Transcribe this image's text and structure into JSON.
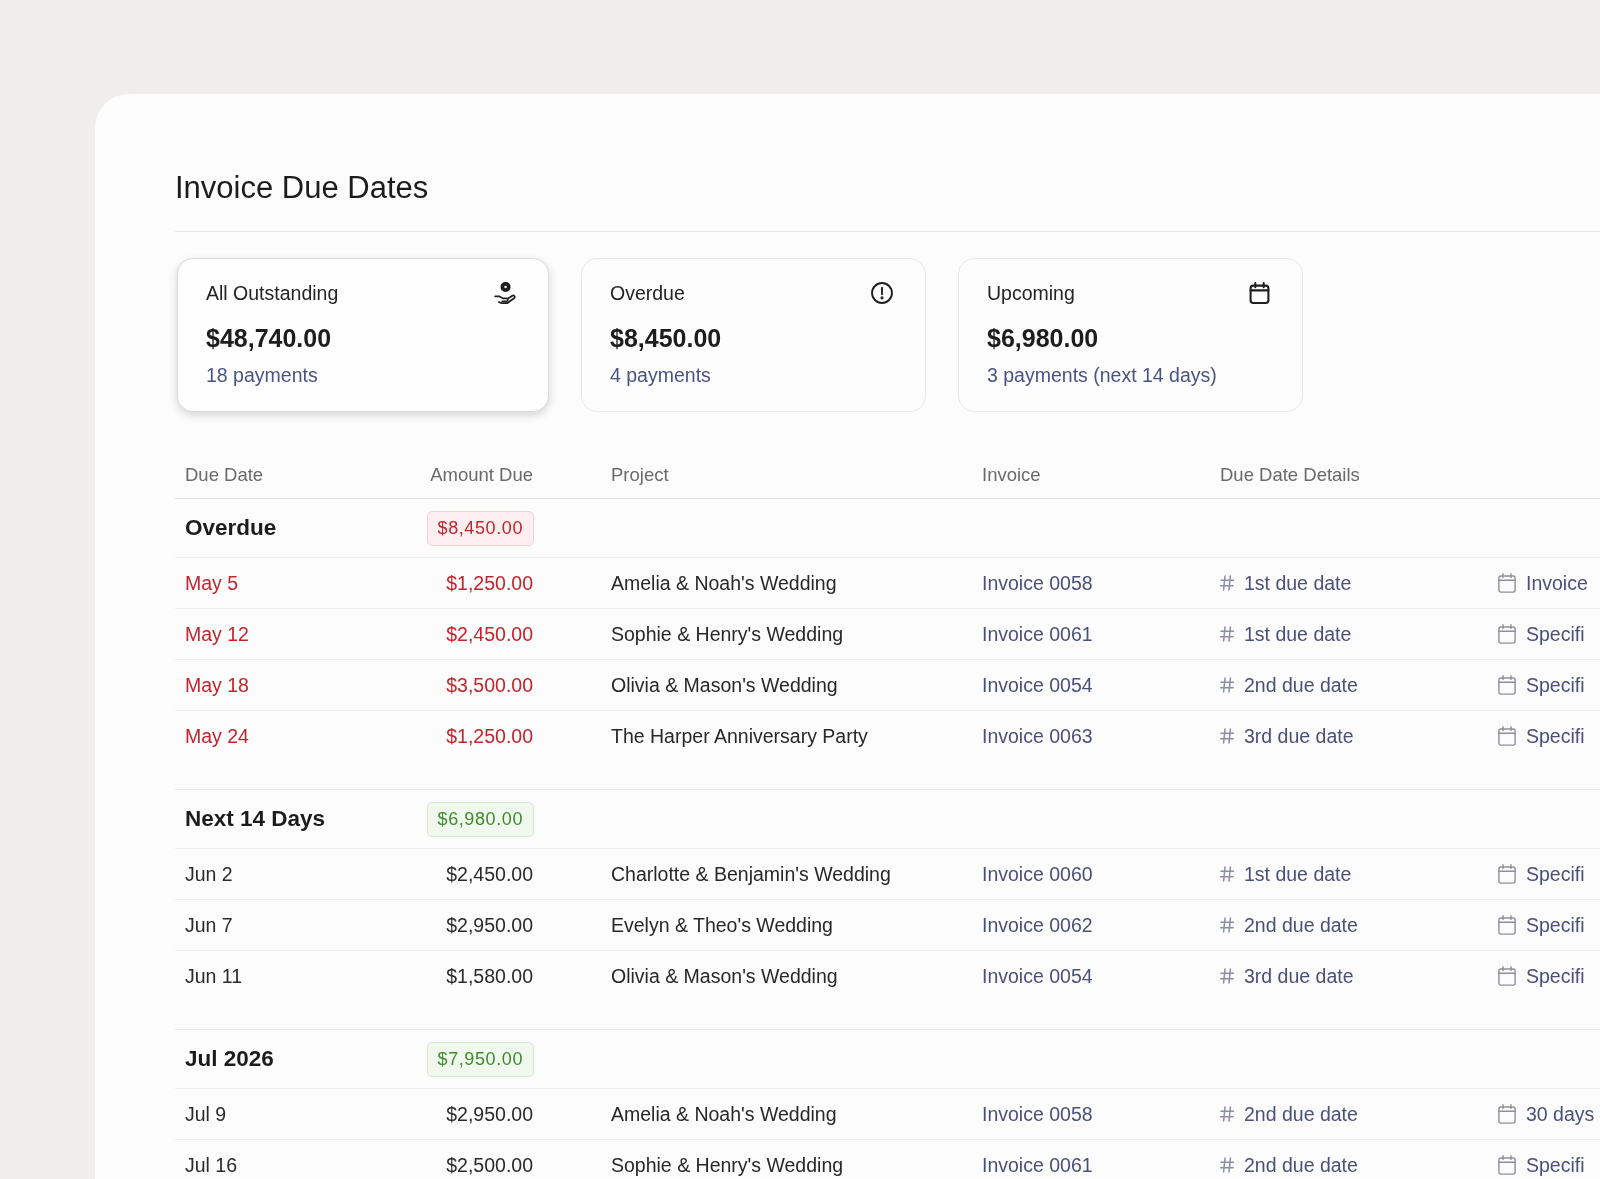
{
  "page": {
    "title": "Invoice Due Dates"
  },
  "summary_cards": [
    {
      "kind": "total",
      "label": "All Outstanding",
      "amount": "$48,740.00",
      "count": "18 payments",
      "selected": true
    },
    {
      "kind": "overdue",
      "label": "Overdue",
      "amount": "$8,450.00",
      "count": "4 payments",
      "selected": false
    },
    {
      "kind": "upcoming",
      "label": "Upcoming",
      "amount": "$6,980.00",
      "count": "3 payments (next 14 days)",
      "selected": false
    }
  ],
  "table": {
    "columns": [
      "Due Date",
      "Amount Due",
      "Project",
      "Invoice",
      "Due Date Details"
    ],
    "groups": [
      {
        "kind": "overdue",
        "title": "Overdue",
        "total": "$8,450.00",
        "rows": [
          {
            "due_date": "May 5",
            "amount": "$1,250.00",
            "project": "Amelia & Noah's Wedding",
            "invoice": "Invoice 0058",
            "due_number": "1st due date",
            "column_6": "Invoice"
          },
          {
            "due_date": "May 12",
            "amount": "$2,450.00",
            "project": "Sophie & Henry's Wedding",
            "invoice": "Invoice 0061",
            "due_number": "1st due date",
            "column_6": "Specifi"
          },
          {
            "due_date": "May 18",
            "amount": "$3,500.00",
            "project": "Olivia & Mason's Wedding",
            "invoice": "Invoice 0054",
            "due_number": "2nd due date",
            "column_6": "Specifi"
          },
          {
            "due_date": "May 24",
            "amount": "$1,250.00",
            "project": "The Harper Anniversary Party",
            "invoice": "Invoice 0063",
            "due_number": "3rd due date",
            "column_6": "Specifi"
          }
        ]
      },
      {
        "kind": "upcoming",
        "title": "Next 14 Days",
        "total": "$6,980.00",
        "rows": [
          {
            "due_date": "Jun 2",
            "amount": "$2,450.00",
            "project": "Charlotte & Benjamin's Wedding",
            "invoice": "Invoice 0060",
            "due_number": "1st due date",
            "column_6": "Specifi"
          },
          {
            "due_date": "Jun 7",
            "amount": "$2,950.00",
            "project": "Evelyn & Theo's Wedding",
            "invoice": "Invoice 0062",
            "due_number": "2nd due date",
            "column_6": "Specifi"
          },
          {
            "due_date": "Jun 11",
            "amount": "$1,580.00",
            "project": "Olivia & Mason's Wedding",
            "invoice": "Invoice 0054",
            "due_number": "3rd due date",
            "column_6": "Specifi"
          }
        ]
      },
      {
        "kind": "upcoming",
        "title": "Jul 2026",
        "total": "$7,950.00",
        "rows": [
          {
            "due_date": "Jul 9",
            "amount": "$2,950.00",
            "project": "Amelia & Noah's Wedding",
            "invoice": "Invoice 0058",
            "due_number": "2nd due date",
            "column_6": "30 days"
          },
          {
            "due_date": "Jul 16",
            "amount": "$2,500.00",
            "project": "Sophie & Henry's Wedding",
            "invoice": "Invoice 0061",
            "due_number": "2nd due date",
            "column_6": "Specifi"
          }
        ]
      }
    ]
  }
}
